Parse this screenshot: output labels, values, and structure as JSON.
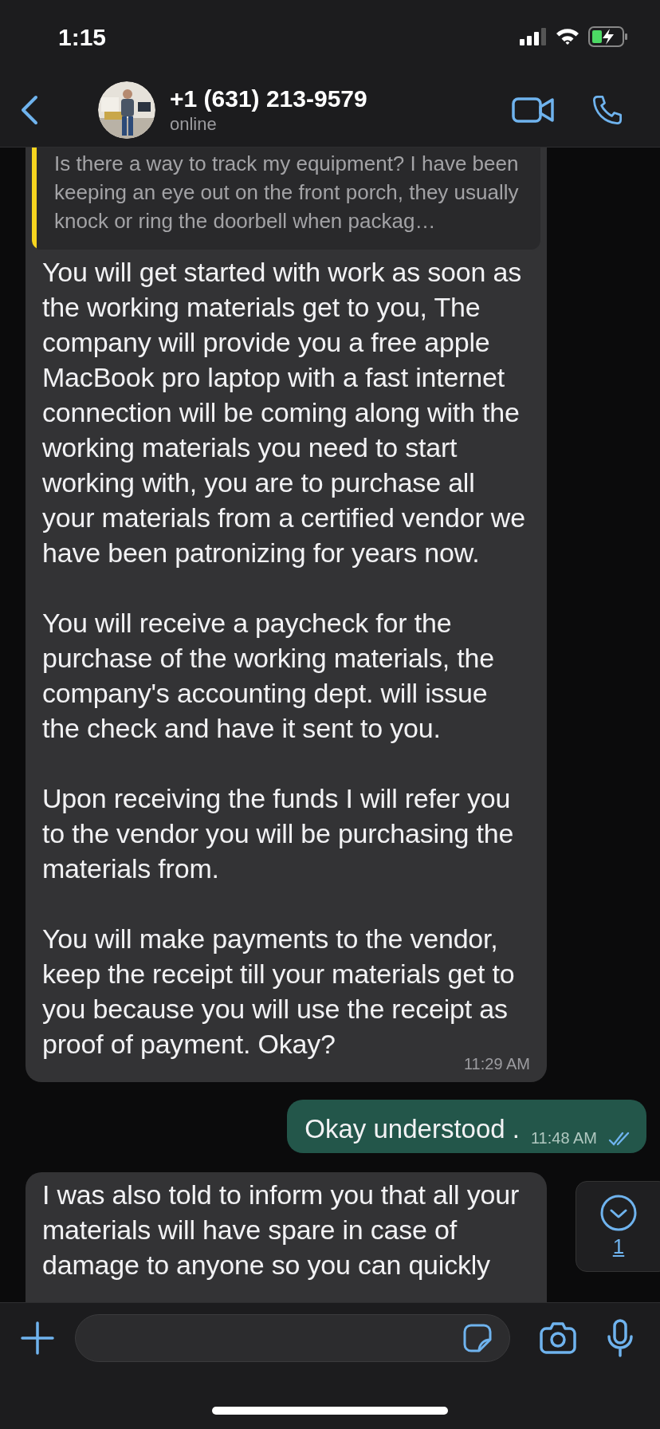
{
  "status_bar": {
    "time": "1:15"
  },
  "header": {
    "title": "+1 (631) 213-9579",
    "status": "online"
  },
  "messages": [
    {
      "kind": "received",
      "quote": "Is there a way to track my equipment? I have been keeping an eye out on the front porch, they usually knock or ring the doorbell when packag…",
      "paragraphs": [
        "You will get started with work as soon as the working materials get to you, The company will provide you a free apple MacBook pro laptop with a fast internet connection will be coming along with the working materials you need to start working with, you are to purchase all your materials from a certified vendor we have been patronizing for years now.",
        "You will receive a paycheck for the purchase of the working materials, the company's accounting dept. will issue the check and have it sent to you.",
        "Upon receiving the funds I will refer you to the vendor you will be purchasing the materials from.",
        "You will make payments to the vendor, keep the receipt till your materials get to you because you will use the receipt as proof of payment. Okay?"
      ],
      "time": "11:29 AM"
    },
    {
      "kind": "sent",
      "paragraphs": [
        "Okay understood ."
      ],
      "time": "11:48 AM",
      "read": true
    },
    {
      "kind": "received",
      "paragraphs": [
        "I was also told to inform you that all your materials will have spare in case of damage to anyone so you can quickly"
      ]
    }
  ],
  "scroll_button": {
    "unread": "1"
  }
}
